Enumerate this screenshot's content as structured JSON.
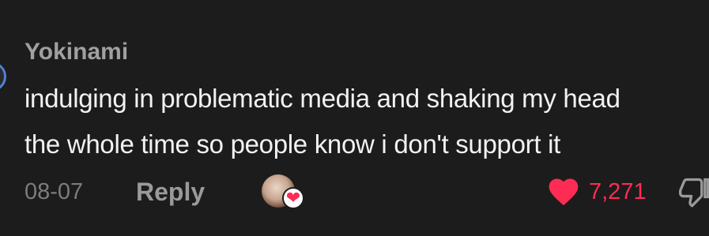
{
  "comment": {
    "username": "Yokinami",
    "text_lines": [
      "indulging in problematic media and shaking my head",
      "the whole time so people know i don't support it"
    ],
    "date": "08-07",
    "reply_label": "Reply",
    "like_count": "7,271",
    "icons": {
      "creator_liked": "heart-icon",
      "like": "heart-icon",
      "dislike": "thumbs-down-icon"
    }
  },
  "colors": {
    "background": "#1c1c1c",
    "accent": "#fe2c55",
    "text": "#f2f2f2",
    "muted": "#a0a0a0"
  }
}
